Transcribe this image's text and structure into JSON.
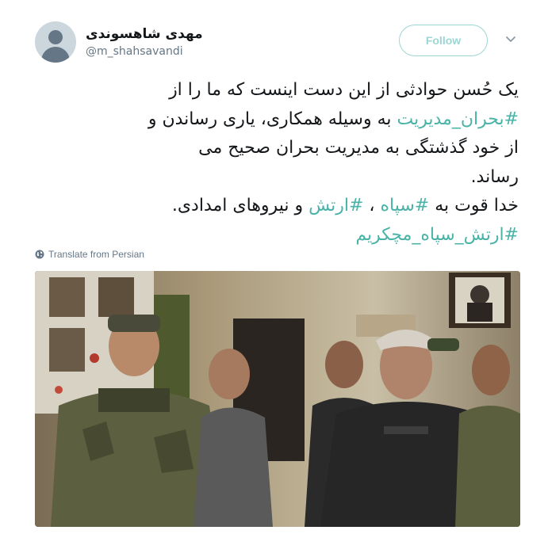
{
  "user": {
    "display_name": "مهدی شاهسوندی",
    "handle": "@m_shahsavandi"
  },
  "follow_label": "Follow",
  "tweet": {
    "line1": "یک حُسن حوادثی از این دست اینست که ما را از",
    "line2_hashtag": "#بحران_مدیریت",
    "line2_text": " به وسیله همکاری، یاری رساندن و",
    "line3": "از خود گذشتگی به مدیریت بحران صحیح می",
    "line4": "رساند.",
    "line5_a": "خدا قوت به ",
    "line5_hashtag1": "#سپاه",
    "line5_b": " ، ",
    "line5_hashtag2": "#ارتش",
    "line5_c": " و نیروهای امدادی.",
    "line6_hashtag": "#ارتش_سپاه_مچکریم"
  },
  "translate_label": "Translate from Persian",
  "colors": {
    "accent": "#4ab3a8",
    "follow_border": "#9cd6d2",
    "secondary_text": "#657786"
  }
}
